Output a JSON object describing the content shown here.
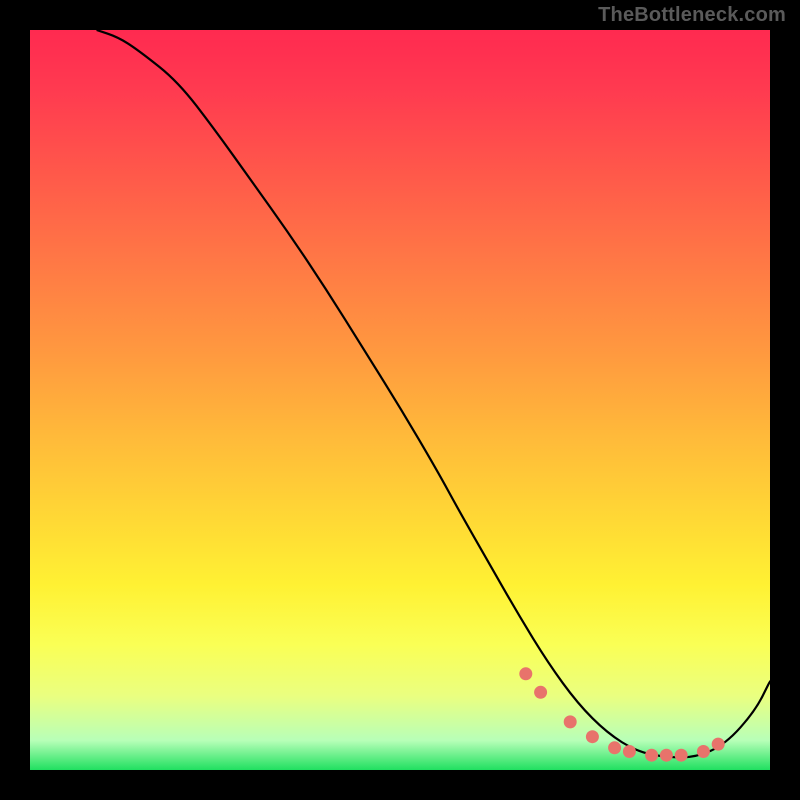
{
  "watermark": "TheBottleneck.com",
  "chart_data": {
    "type": "line",
    "title": "",
    "xlabel": "",
    "ylabel": "",
    "xlim": [
      0,
      100
    ],
    "ylim": [
      0,
      100
    ],
    "grid": false,
    "series": [
      {
        "name": "curve",
        "color": "#000000",
        "x": [
          9,
          12,
          15,
          20,
          25,
          30,
          35,
          40,
          45,
          50,
          55,
          58,
          62,
          66,
          70,
          74,
          78,
          82,
          86,
          90,
          94,
          98,
          100
        ],
        "y": [
          100,
          99,
          97,
          93,
          86.5,
          79.5,
          72.5,
          65,
          57,
          49,
          40.5,
          35,
          28,
          21,
          14.5,
          9,
          5,
          2.5,
          1.7,
          1.7,
          3.5,
          8,
          12
        ]
      }
    ],
    "highlight_dots": {
      "color": "#e8736b",
      "x": [
        67,
        69,
        73,
        76,
        79,
        81,
        84,
        86,
        88,
        91,
        93
      ],
      "y": [
        13,
        10.5,
        6.5,
        4.5,
        3,
        2.5,
        2,
        2,
        2,
        2.5,
        3.5
      ]
    },
    "background_gradient": {
      "stops": [
        {
          "pct": 0,
          "color": "#ff2a50"
        },
        {
          "pct": 20,
          "color": "#ff5a4a"
        },
        {
          "pct": 44,
          "color": "#ff9a3f"
        },
        {
          "pct": 66,
          "color": "#ffd835"
        },
        {
          "pct": 83,
          "color": "#faff55"
        },
        {
          "pct": 96,
          "color": "#b8ffb8"
        },
        {
          "pct": 100,
          "color": "#20e060"
        }
      ]
    }
  }
}
